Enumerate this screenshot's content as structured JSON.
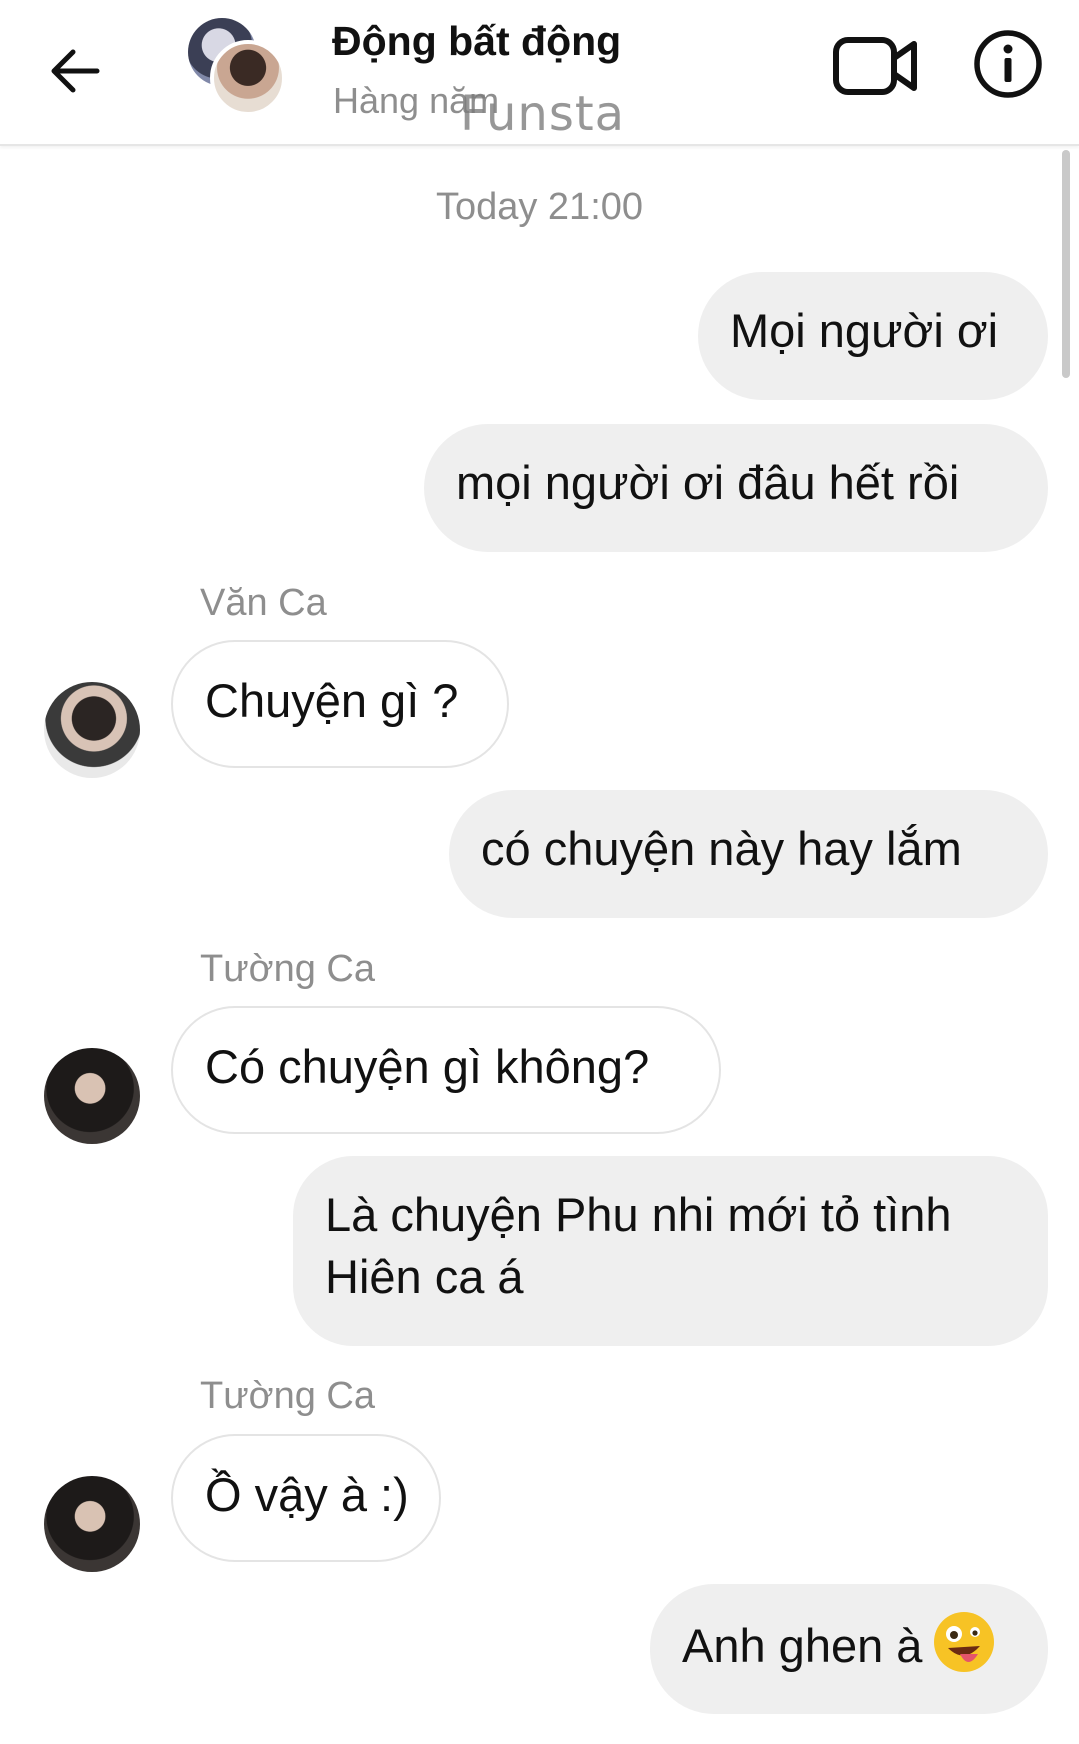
{
  "header": {
    "title": "Động bất động",
    "subtitle": "Hàng năm",
    "watermark": "Funsta"
  },
  "conversation": {
    "timestamp": "Today 21:00",
    "messages": [
      {
        "text": "Mọi người ơi"
      },
      {
        "text": "mọi người ơi đâu hết rồi"
      },
      {
        "sender": "Văn Ca",
        "text": "Chuyện gì ?"
      },
      {
        "text": "có chuyện này hay lắm"
      },
      {
        "sender": "Tường Ca",
        "text": "Có chuyện gì không?"
      },
      {
        "text": "Là chuyện Phu nhi mới tỏ tình Hiên ca á"
      },
      {
        "sender": "Tường Ca",
        "text": "Ồ vậy à :)"
      },
      {
        "text": "Anh ghen à",
        "emoji": "zany-face-emoji"
      }
    ]
  },
  "icons": {
    "back": "arrow-left-icon",
    "video": "video-camera-icon",
    "info": "info-icon"
  },
  "colors": {
    "mine_bubble": "#efefef",
    "theirs_bubble_border": "#e4e4e4",
    "secondary_text": "#8e8e8e"
  }
}
